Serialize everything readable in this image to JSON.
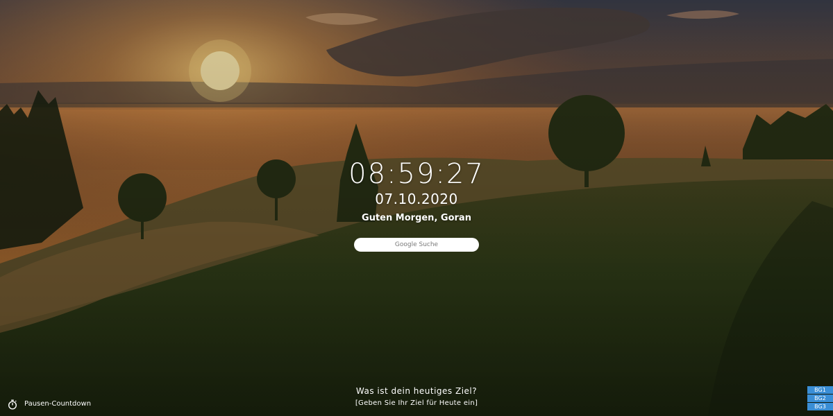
{
  "clock": {
    "time": "08:59:27",
    "date": "07.10.2020"
  },
  "greeting": "Guten Morgen, Goran",
  "search": {
    "placeholder": "Google Suche"
  },
  "goal": {
    "question": "Was ist dein heutiges Ziel?",
    "hint": "[Geben Sie Ihr Ziel für Heute ein]"
  },
  "pause": {
    "label": "Pausen-Countdown",
    "icon": "stopwatch-icon"
  },
  "backgrounds": {
    "bg1": "BG1",
    "bg2": "BG2",
    "bg3": "BG3"
  },
  "colors": {
    "bg_button": "#3a8ed6",
    "text": "#ffffff"
  }
}
